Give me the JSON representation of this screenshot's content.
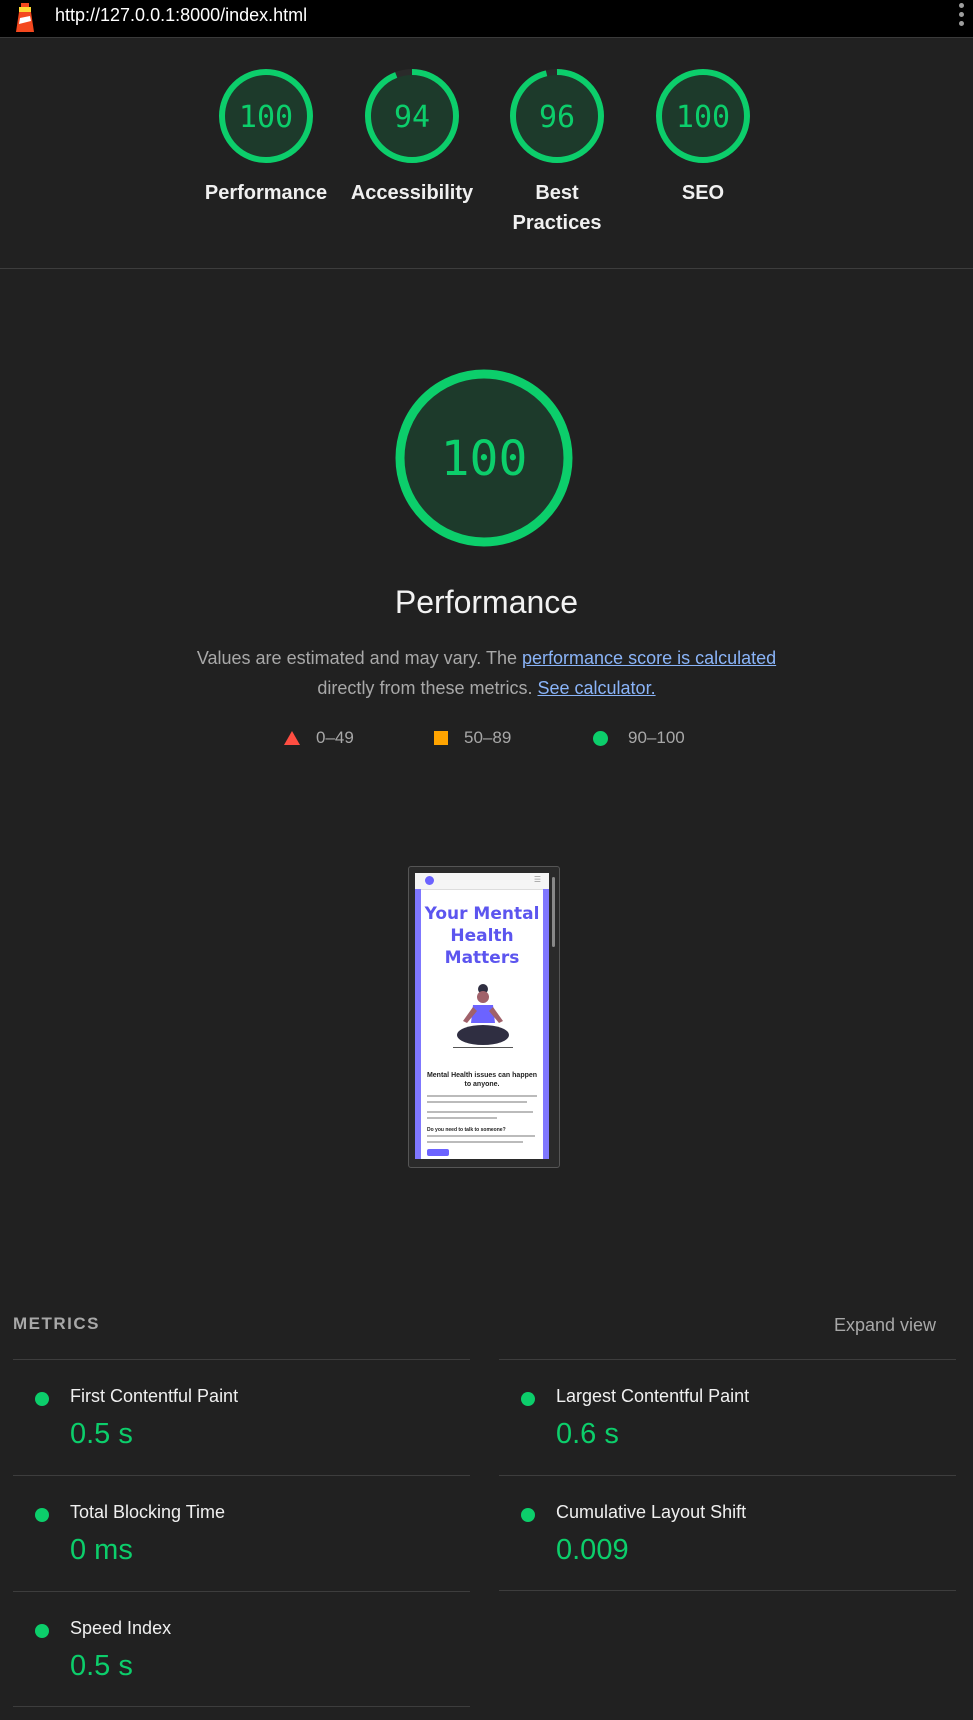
{
  "topbar": {
    "url": "http://127.0.0.1:8000/index.html"
  },
  "gauges": [
    {
      "score": "100",
      "label": "Performance",
      "fraction": 1.0
    },
    {
      "score": "94",
      "label": "Accessibility",
      "fraction": 0.94
    },
    {
      "score": "96",
      "label": "Best Practices",
      "fraction": 0.96
    },
    {
      "score": "100",
      "label": "SEO",
      "fraction": 1.0
    }
  ],
  "main": {
    "score": "100",
    "title": "Performance",
    "desc_prefix": "Values are estimated and may vary. The ",
    "desc_link1": "performance score is calculated",
    "desc_middle": "directly from these metrics.",
    "desc_link2": "See calculator."
  },
  "legend": [
    {
      "range": "0–49"
    },
    {
      "range": "50–89"
    },
    {
      "range": "90–100"
    }
  ],
  "thumbnail": {
    "headline": "Your Mental Health Matters",
    "subhead": "Mental Health issues can happen to anyone.",
    "question": "Do you need to talk to someone?"
  },
  "metrics": {
    "title": "METRICS",
    "expand_label": "Expand view",
    "items": [
      {
        "name": "First Contentful Paint",
        "value": "0.5 s"
      },
      {
        "name": "Largest Contentful Paint",
        "value": "0.6 s"
      },
      {
        "name": "Total Blocking Time",
        "value": "0 ms"
      },
      {
        "name": "Cumulative Layout Shift",
        "value": "0.009"
      },
      {
        "name": "Speed Index",
        "value": "0.5 s"
      }
    ]
  },
  "colors": {
    "pass": "#0cce6b",
    "average": "#ffa400",
    "fail": "#ff4e42",
    "link": "#8ab4f8"
  }
}
